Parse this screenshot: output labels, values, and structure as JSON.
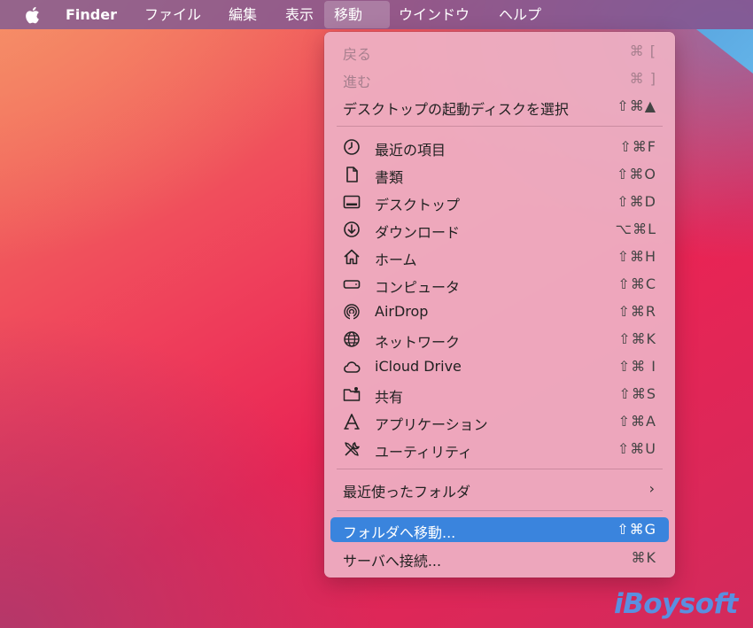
{
  "menubar": {
    "app_name": "Finder",
    "items": [
      "ファイル",
      "編集",
      "表示",
      "移動",
      "ウインドウ",
      "ヘルプ"
    ],
    "active_item": "移動"
  },
  "menu": {
    "back": {
      "label": "戻る",
      "shortcut": "⌘ ["
    },
    "forward": {
      "label": "進む",
      "shortcut": "⌘ ]"
    },
    "startup_disk": {
      "label": "デスクトップの起動ディスクを選択",
      "shortcut": "⇧⌘▲"
    },
    "items": [
      {
        "label": "最近の項目",
        "shortcut": "⇧⌘F",
        "icon": "clock-icon"
      },
      {
        "label": "書類",
        "shortcut": "⇧⌘O",
        "icon": "document-icon"
      },
      {
        "label": "デスクトップ",
        "shortcut": "⇧⌘D",
        "icon": "desktop-icon"
      },
      {
        "label": "ダウンロード",
        "shortcut": "⌥⌘L",
        "icon": "download-icon"
      },
      {
        "label": "ホーム",
        "shortcut": "⇧⌘H",
        "icon": "home-icon"
      },
      {
        "label": "コンピュータ",
        "shortcut": "⇧⌘C",
        "icon": "computer-icon"
      },
      {
        "label": "AirDrop",
        "shortcut": "⇧⌘R",
        "icon": "airdrop-icon"
      },
      {
        "label": "ネットワーク",
        "shortcut": "⇧⌘K",
        "icon": "network-icon"
      },
      {
        "label": "iCloud Drive",
        "shortcut": "⇧⌘ I",
        "icon": "cloud-icon"
      },
      {
        "label": "共有",
        "shortcut": "⇧⌘S",
        "icon": "shared-folder-icon"
      },
      {
        "label": "アプリケーション",
        "shortcut": "⇧⌘A",
        "icon": "applications-icon"
      },
      {
        "label": "ユーティリティ",
        "shortcut": "⇧⌘U",
        "icon": "utilities-icon"
      }
    ],
    "recent_folders": {
      "label": "最近使ったフォルダ",
      "arrow": "›"
    },
    "go_to_folder": {
      "label": "フォルダへ移動...",
      "shortcut": "⇧⌘G"
    },
    "connect_server": {
      "label": "サーバへ接続...",
      "shortcut": "⌘K"
    }
  },
  "watermark": "iBoysoft",
  "colors": {
    "selection": "#3a84dd",
    "menu_bg": "#eeb0c4",
    "watermark": "#5a8fe0"
  }
}
